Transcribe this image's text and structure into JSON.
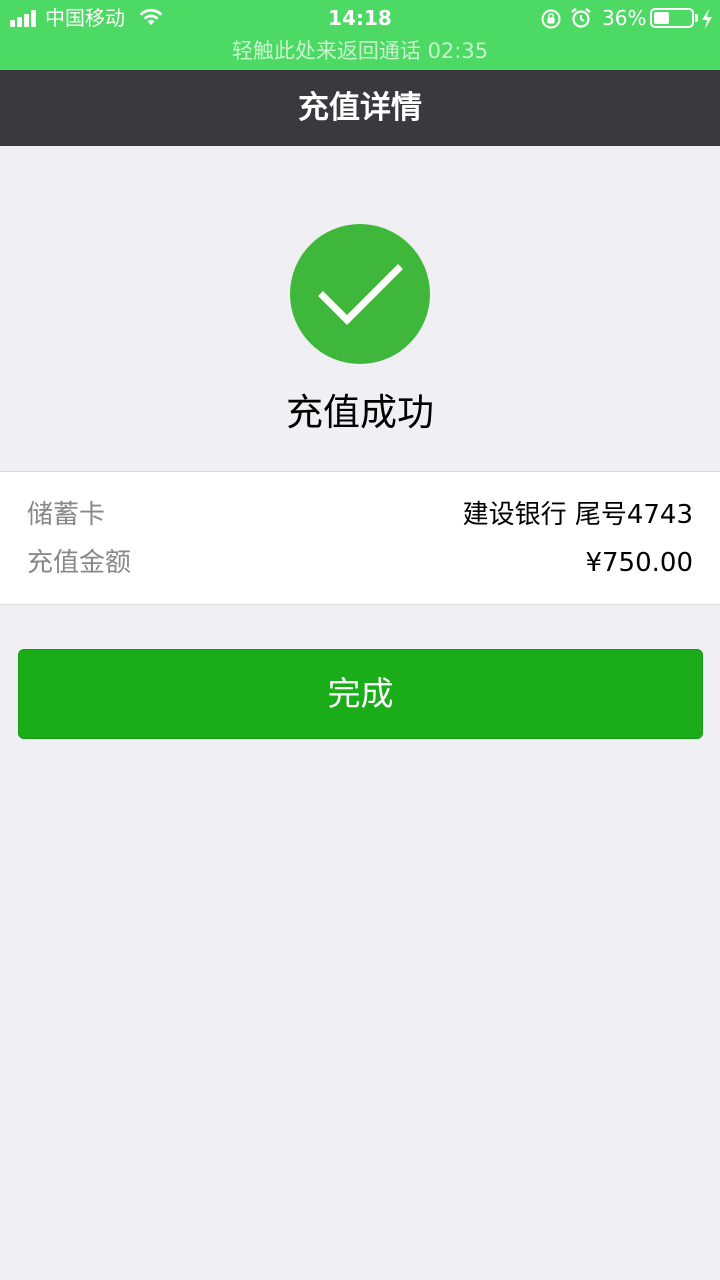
{
  "status_bar": {
    "carrier": "中国移动",
    "time": "14:18",
    "battery_percent_text": "36%",
    "battery_level": 0.36,
    "icons": [
      "signal-icon",
      "wifi-icon",
      "rotation-lock-icon",
      "alarm-icon",
      "battery-icon",
      "charging-icon"
    ]
  },
  "call_banner": {
    "text": "轻触此处来返回通话 02:35"
  },
  "nav": {
    "title": "充值详情"
  },
  "result": {
    "icon": "checkmark-icon",
    "message": "充值成功"
  },
  "details": {
    "rows": [
      {
        "label": "储蓄卡",
        "value": "建设银行 尾号4743"
      },
      {
        "label": "充值金额",
        "value": "¥750.00"
      }
    ]
  },
  "actions": {
    "done_label": "完成"
  },
  "colors": {
    "status_bar_bg": "#4cd964",
    "nav_bg": "#393a3f",
    "page_bg": "#efeff4",
    "success_green": "#3eb73b",
    "button_green": "#1aad19"
  }
}
